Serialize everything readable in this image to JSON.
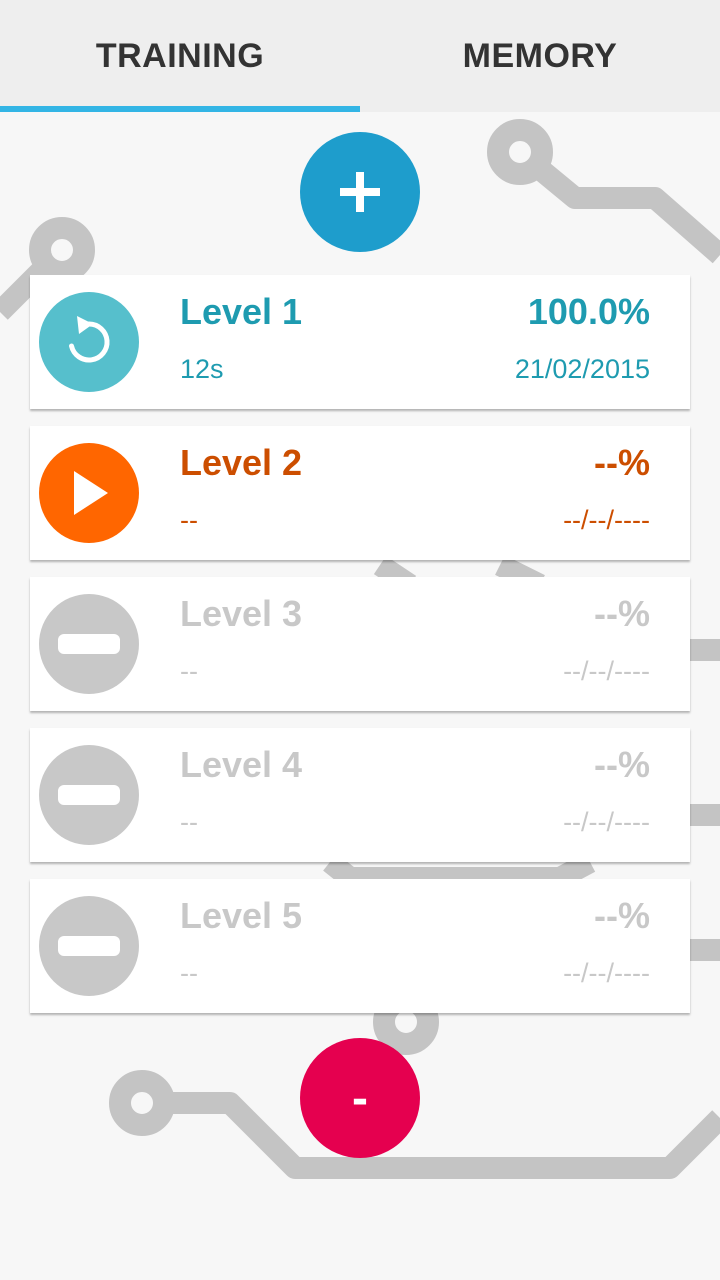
{
  "tabs": [
    {
      "label": "TRAINING",
      "active": true
    },
    {
      "label": "MEMORY",
      "active": false
    }
  ],
  "colors": {
    "accent_blue": "#1e9dcc",
    "indicator": "#33b5e5",
    "completed_text": "#1e9bb0",
    "completed_icon": "#56bfcc",
    "current_text": "#cc4e00",
    "current_icon": "#ff6600",
    "locked": "#c8c8c8",
    "remove_pink": "#e5004f"
  },
  "add_button": {
    "icon": "plus-icon"
  },
  "remove_button": {
    "label": "-"
  },
  "levels": [
    {
      "title": "Level 1",
      "percent": "100.0%",
      "time": "12s",
      "date": "21/02/2015",
      "state": "completed",
      "icon": "replay-icon"
    },
    {
      "title": "Level 2",
      "percent": "--%",
      "time": "--",
      "date": "--/--/----",
      "state": "current",
      "icon": "play-icon"
    },
    {
      "title": "Level 3",
      "percent": "--%",
      "time": "--",
      "date": "--/--/----",
      "state": "locked",
      "icon": "locked-icon"
    },
    {
      "title": "Level 4",
      "percent": "--%",
      "time": "--",
      "date": "--/--/----",
      "state": "locked",
      "icon": "locked-icon"
    },
    {
      "title": "Level 5",
      "percent": "--%",
      "time": "--",
      "date": "--/--/----",
      "state": "locked",
      "icon": "locked-icon"
    }
  ]
}
